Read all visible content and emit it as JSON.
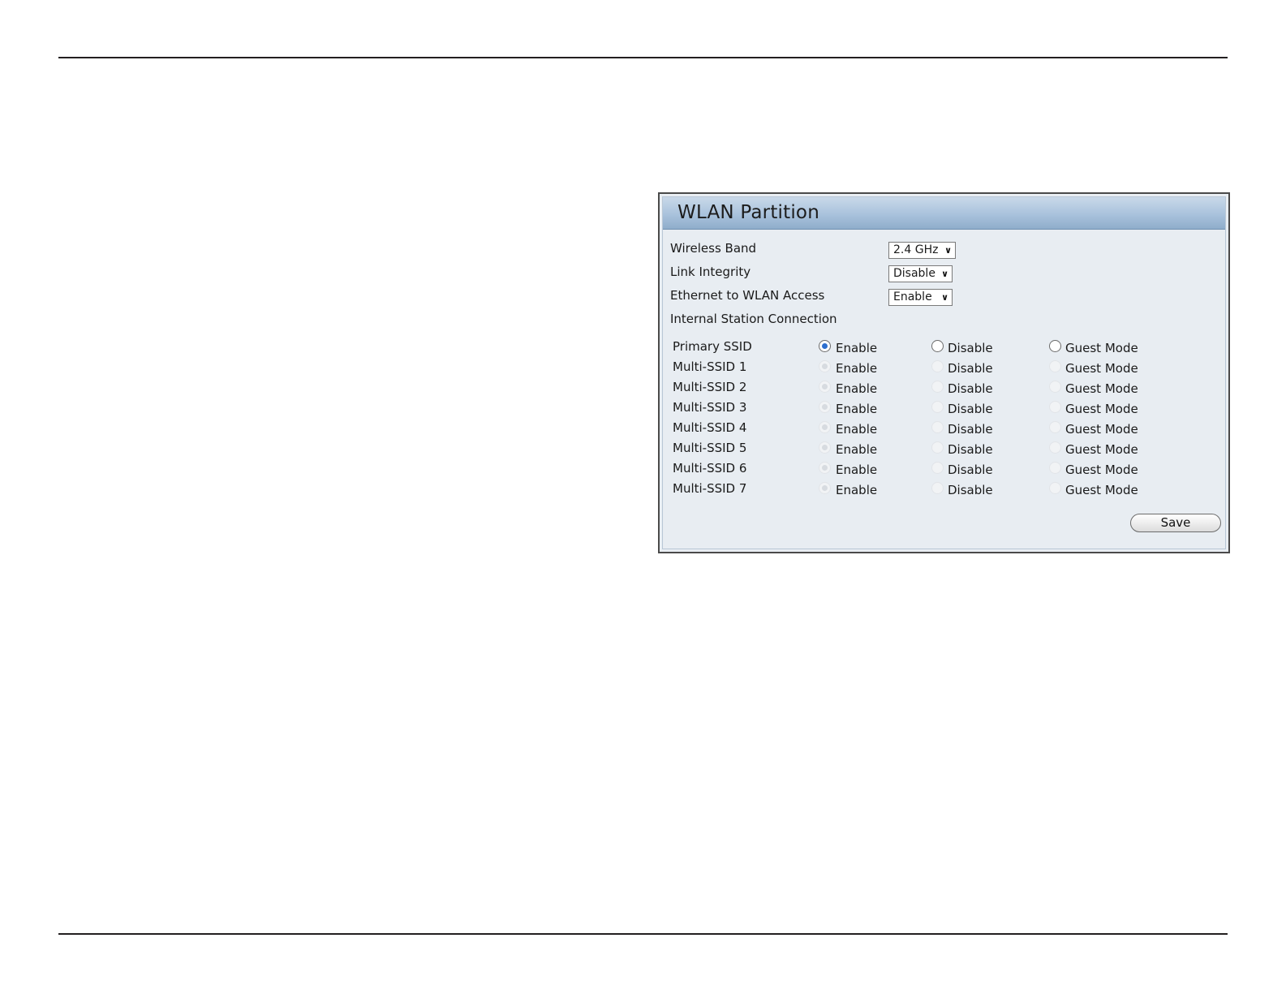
{
  "panel": {
    "title": "WLAN Partition",
    "fields": {
      "wireless_band": {
        "label": "Wireless Band",
        "value": "2.4 GHz"
      },
      "link_integrity": {
        "label": "Link Integrity",
        "value": "Disable"
      },
      "ethernet_to_wlan": {
        "label": "Ethernet to WLAN Access",
        "value": "Enable"
      },
      "internal_station": {
        "label": "Internal Station Connection"
      }
    },
    "options": {
      "enable": "Enable",
      "disable": "Disable",
      "guest": "Guest Mode"
    },
    "ssids": [
      {
        "label": "Primary SSID",
        "selected": "enable",
        "disabled": false
      },
      {
        "label": "Multi-SSID 1",
        "selected": "enable",
        "disabled": true
      },
      {
        "label": "Multi-SSID 2",
        "selected": "enable",
        "disabled": true
      },
      {
        "label": "Multi-SSID 3",
        "selected": "enable",
        "disabled": true
      },
      {
        "label": "Multi-SSID 4",
        "selected": "enable",
        "disabled": true
      },
      {
        "label": "Multi-SSID 5",
        "selected": "enable",
        "disabled": true
      },
      {
        "label": "Multi-SSID 6",
        "selected": "enable",
        "disabled": true
      },
      {
        "label": "Multi-SSID 7",
        "selected": "enable",
        "disabled": true
      }
    ],
    "save_label": "Save"
  },
  "colors": {
    "header_gradient_top": "#c9d9e9",
    "header_gradient_bottom": "#8fadcb",
    "panel_background": "#e8edf2",
    "radio_checked": "#2d6fcf"
  }
}
